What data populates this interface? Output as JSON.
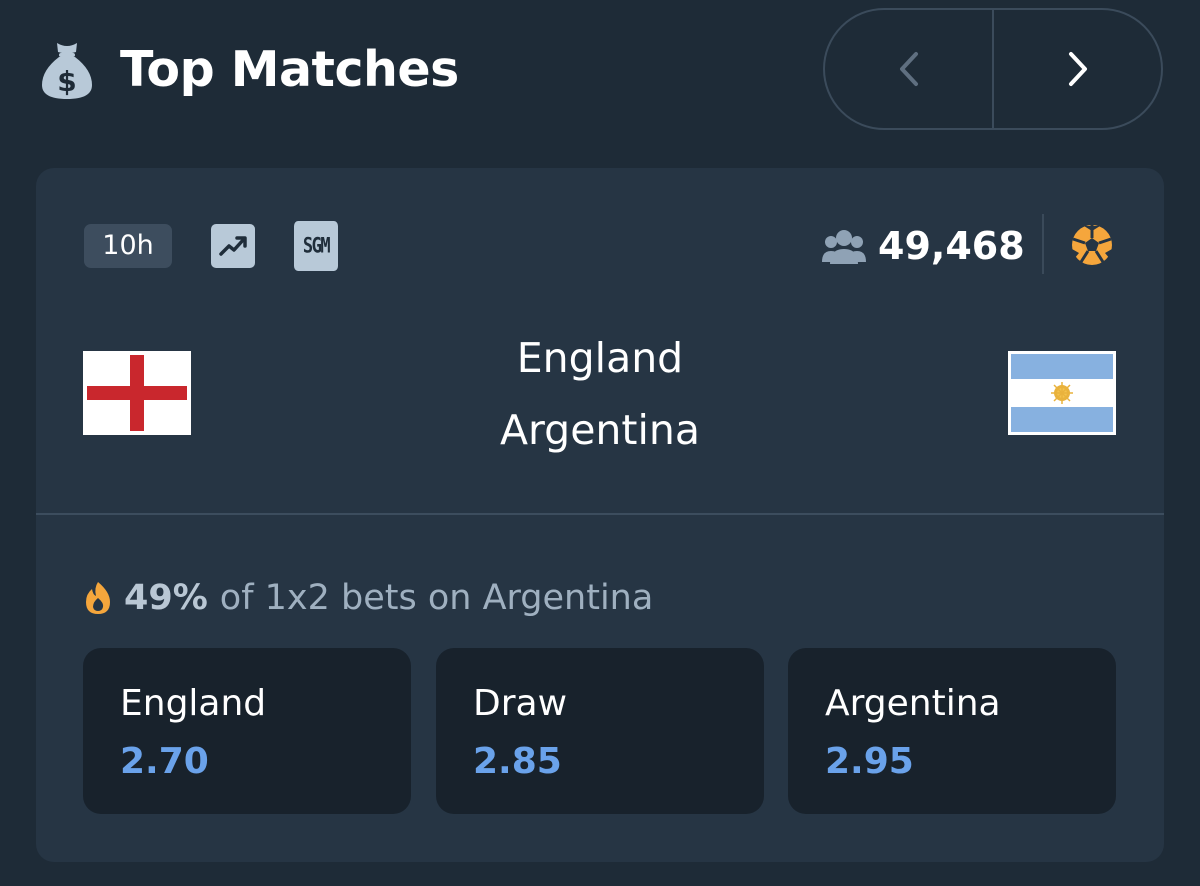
{
  "header": {
    "title": "Top Matches",
    "icon": "money-bag-icon"
  },
  "nav": {
    "prev_icon": "chevron-left-icon",
    "next_icon": "chevron-right-icon"
  },
  "match": {
    "time_badge": "10h",
    "trend_icon": "trending-up-icon",
    "sgm_label": "SGM",
    "bettor_count": "49,468",
    "sport_icon": "soccer-ball-icon",
    "home_team": "England",
    "away_team": "Argentina",
    "home_flag": "england-flag",
    "away_flag": "argentina-flag"
  },
  "bet_stats": {
    "percent": "49%",
    "text": "of 1x2 bets on Argentina",
    "icon": "flame-icon"
  },
  "odds": [
    {
      "label": "England",
      "price": "2.70"
    },
    {
      "label": "Draw",
      "price": "2.85"
    },
    {
      "label": "Argentina",
      "price": "2.95"
    }
  ],
  "colors": {
    "background": "#1e2b37",
    "card": "#263544",
    "odds_button": "#18222c",
    "odds_price": "#6aa2ea",
    "accent_orange": "#f5a63c",
    "england_cross": "#c9272d",
    "argentina_blue": "#87b1e0"
  }
}
